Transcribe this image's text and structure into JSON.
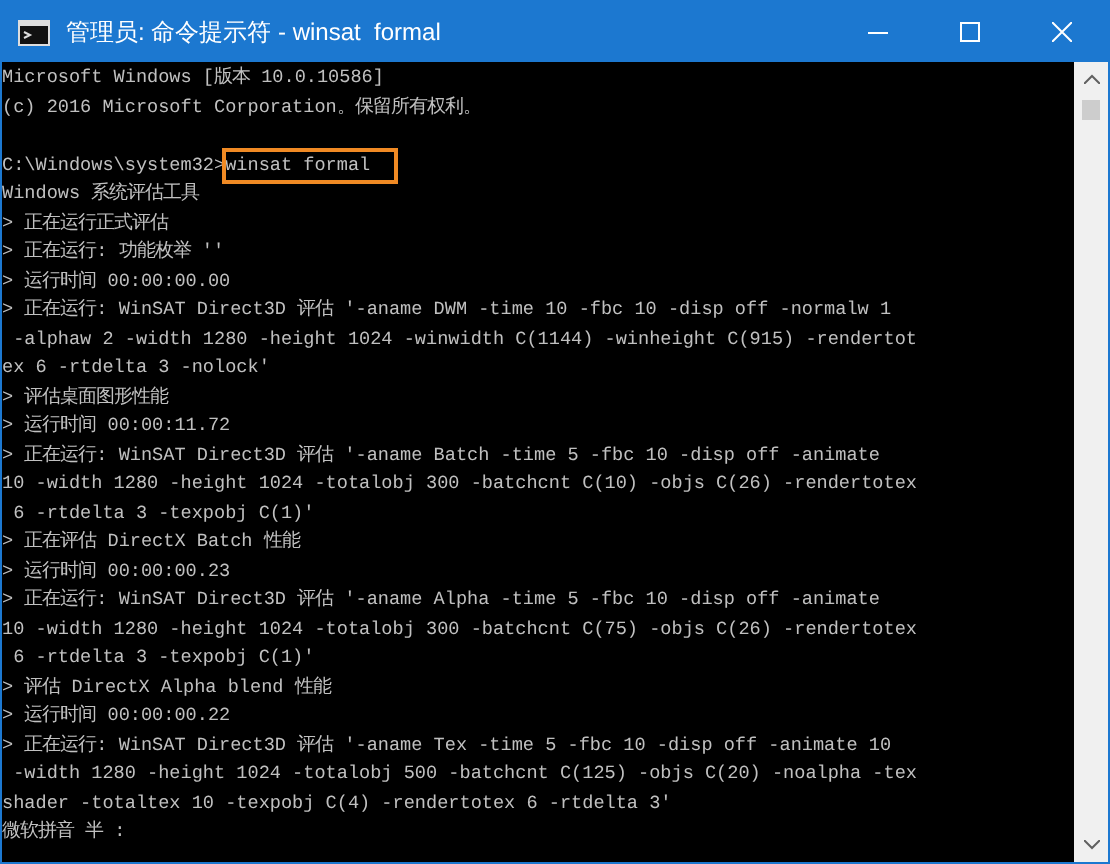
{
  "window": {
    "title": "管理员: 命令提示符 - winsat  formal"
  },
  "console": {
    "lines": [
      {
        "kind": "text",
        "text": "Microsoft Windows [版本 10.0.10586]"
      },
      {
        "kind": "text",
        "text": "(c) 2016 Microsoft Corporation。保留所有权利。"
      },
      {
        "kind": "blank"
      },
      {
        "kind": "command",
        "prompt": "C:\\Windows\\system32>",
        "command": "winsat formal",
        "highlighted": true
      },
      {
        "kind": "text",
        "text": "Windows 系统评估工具"
      },
      {
        "kind": "text",
        "text": "> 正在运行正式评估"
      },
      {
        "kind": "text",
        "text": "> 正在运行: 功能枚举 ''"
      },
      {
        "kind": "text",
        "text": "> 运行时间 00:00:00.00"
      },
      {
        "kind": "text",
        "text": "> 正在运行: WinSAT Direct3D 评估 '-aname DWM -time 10 -fbc 10 -disp off -normalw 1"
      },
      {
        "kind": "text",
        "text": " -alphaw 2 -width 1280 -height 1024 -winwidth C(1144) -winheight C(915) -rendertot"
      },
      {
        "kind": "text",
        "text": "ex 6 -rtdelta 3 -nolock'"
      },
      {
        "kind": "text",
        "text": "> 评估桌面图形性能"
      },
      {
        "kind": "text",
        "text": "> 运行时间 00:00:11.72"
      },
      {
        "kind": "text",
        "text": "> 正在运行: WinSAT Direct3D 评估 '-aname Batch -time 5 -fbc 10 -disp off -animate"
      },
      {
        "kind": "text",
        "text": "10 -width 1280 -height 1024 -totalobj 300 -batchcnt C(10) -objs C(26) -rendertotex"
      },
      {
        "kind": "text",
        "text": " 6 -rtdelta 3 -texpobj C(1)'"
      },
      {
        "kind": "text",
        "text": "> 正在评估 DirectX Batch 性能"
      },
      {
        "kind": "text",
        "text": "> 运行时间 00:00:00.23"
      },
      {
        "kind": "text",
        "text": "> 正在运行: WinSAT Direct3D 评估 '-aname Alpha -time 5 -fbc 10 -disp off -animate"
      },
      {
        "kind": "text",
        "text": "10 -width 1280 -height 1024 -totalobj 300 -batchcnt C(75) -objs C(26) -rendertotex"
      },
      {
        "kind": "text",
        "text": " 6 -rtdelta 3 -texpobj C(1)'"
      },
      {
        "kind": "text",
        "text": "> 评估 DirectX Alpha blend 性能"
      },
      {
        "kind": "text",
        "text": "> 运行时间 00:00:00.22"
      },
      {
        "kind": "text",
        "text": "> 正在运行: WinSAT Direct3D 评估 '-aname Tex -time 5 -fbc 10 -disp off -animate 10"
      },
      {
        "kind": "text",
        "text": " -width 1280 -height 1024 -totalobj 500 -batchcnt C(125) -objs C(20) -noalpha -tex"
      },
      {
        "kind": "text",
        "text": "shader -totaltex 10 -texpobj C(4) -rendertotex 6 -rtdelta 3'"
      },
      {
        "kind": "text",
        "text": "微软拼音 半 :"
      }
    ]
  }
}
